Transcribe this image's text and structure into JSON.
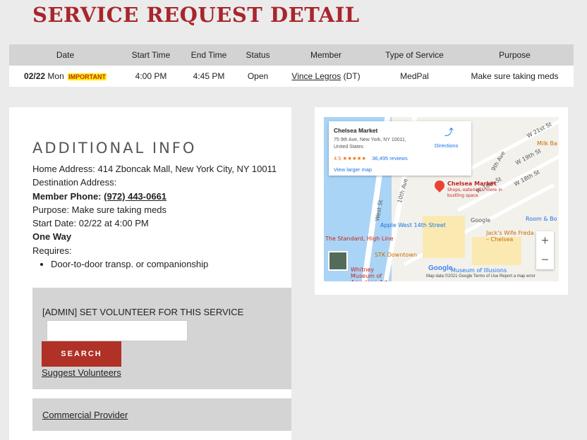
{
  "page_title": "SERVICE REQUEST DETAIL",
  "table": {
    "headers": [
      "Date",
      "Start Time",
      "End Time",
      "Status",
      "Member",
      "Type of Service",
      "Purpose"
    ],
    "row": {
      "date_day": "02/22",
      "date_weekday": "Mon",
      "badge": "IMPORTANT",
      "start_time": "4:00 PM",
      "end_time": "4:45 PM",
      "status": "Open",
      "member_name": "Vince Legros",
      "member_suffix": "(DT)",
      "service_type": "MedPal",
      "purpose": "Make sure taking meds"
    }
  },
  "additional_info": {
    "title": "ADDITIONAL INFO",
    "home_address": "Home Address: 414 Zboncak Mall, New York City, NY 10011",
    "destination_address": "Destination Address:",
    "member_phone_label": "Member Phone:",
    "member_phone": "(972) 443-0661",
    "purpose": "Purpose: Make sure taking meds",
    "start_date": "Start Date: 02/22 at 4:00 PM",
    "trip_type": "One Way",
    "requires_label": "Requires:",
    "requires_items": [
      "Door-to-door transp. or companionship"
    ]
  },
  "admin": {
    "title": "[ADMIN] SET VOLUNTEER FOR THIS SERVICE",
    "volunteer_input_value": "",
    "search_label": "SEARCH",
    "suggest_label": "Suggest Volunteers"
  },
  "commercial_provider_label": "Commercial Provider",
  "map": {
    "place_name": "Chelsea Market",
    "place_address": "75 9th Ave, New York, NY 10011, United States",
    "rating": "4.5",
    "stars": "★★★★★",
    "reviews": "36,495 reviews",
    "directions_label": "Directions",
    "larger_map_label": "View larger map",
    "pin_label": "Chelsea Market",
    "pin_sublabel": "Shops, eateries & more in bustling space",
    "labels": {
      "apple": "Apple West 14th Street",
      "google": "Google",
      "standard": "The Standard, High Line",
      "stk": "STK Downtown",
      "whitney": "Whitney Museum of American Art",
      "illusions": "Museum of Illusions",
      "room": "Room & Bo",
      "jacks": "Jack's Wife Freda – Chelsea",
      "milk": "Milk Ba",
      "west_st": "West St",
      "tenth_ave": "10th Ave",
      "ninth_ave": "9th Ave",
      "w16": "W 16th St",
      "w18": "W 18th St",
      "w19": "W 19th St",
      "w21": "W 21st St"
    },
    "logo": "Google",
    "footer": "Map data ©2021 Google    Terms of Use    Report a map error",
    "zoom_in": "+",
    "zoom_out": "−"
  },
  "colors": {
    "title_red": "#a8262c",
    "button_red": "#b03126",
    "badge_yellow": "#ffee00",
    "link_blue": "#1a73e8"
  }
}
